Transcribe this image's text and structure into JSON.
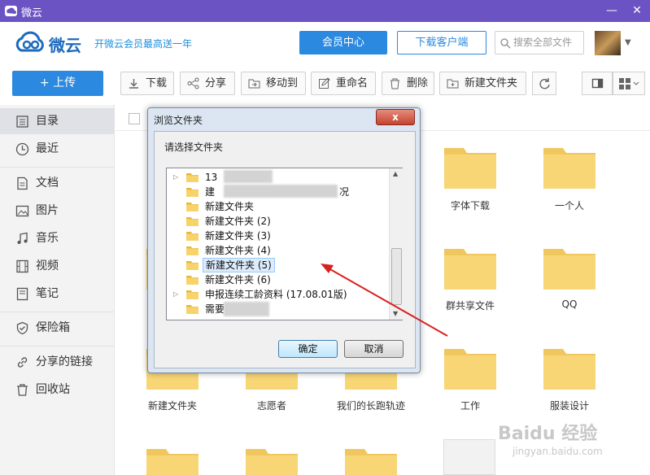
{
  "titlebar": {
    "title": "微云",
    "minimize": "—",
    "close": "✕"
  },
  "header": {
    "brand": "微云",
    "promo": "开微云会员最高送一年",
    "vip_button": "会员中心",
    "download_button": "下载客户端",
    "search_placeholder": "搜索全部文件"
  },
  "toolbar": {
    "upload": "+ 上传",
    "buttons": [
      "下载",
      "分享",
      "移动到",
      "重命名",
      "删除",
      "新建文件夹"
    ]
  },
  "sidebar": {
    "items": [
      "目录",
      "最近",
      "文档",
      "图片",
      "音乐",
      "视频",
      "笔记",
      "保险箱",
      "分享的链接",
      "回收站"
    ]
  },
  "content": {
    "folders": [
      {
        "label": "字体下载"
      },
      {
        "label": "一个人"
      },
      {
        "label": "群共享文件"
      },
      {
        "label": "QQ"
      },
      {
        "label": "新建文件夹"
      },
      {
        "label": "志愿者"
      },
      {
        "label": "我们的长跑轨迹"
      },
      {
        "label": "工作"
      },
      {
        "label": "服装设计"
      }
    ]
  },
  "dialog": {
    "title": "浏览文件夹",
    "close": "x",
    "prompt": "请选择文件夹",
    "tree": [
      {
        "label": "13",
        "expandable": true
      },
      {
        "label": "建",
        "expandable": false
      },
      {
        "label": "新建文件夹",
        "expandable": false
      },
      {
        "label": "新建文件夹 (2)",
        "expandable": false
      },
      {
        "label": "新建文件夹 (3)",
        "expandable": false
      },
      {
        "label": "新建文件夹 (4)",
        "expandable": false
      },
      {
        "label": "新建文件夹 (5)",
        "expandable": false,
        "selected": true
      },
      {
        "label": "新建文件夹 (6)",
        "expandable": false
      },
      {
        "label": "申报连续工龄资料 (17.08.01版)",
        "expandable": true
      },
      {
        "label": "需要",
        "expandable": false
      }
    ],
    "tree_tail": "况",
    "ok": "确定",
    "cancel": "取消"
  },
  "watermark": {
    "text": "Baidu 经验",
    "sub": "jingyan.baidu.com"
  },
  "colors": {
    "accent": "#2b89e0",
    "titlebar": "#6b53c4",
    "folder": "#f8d676",
    "arrow": "#d9201f"
  }
}
